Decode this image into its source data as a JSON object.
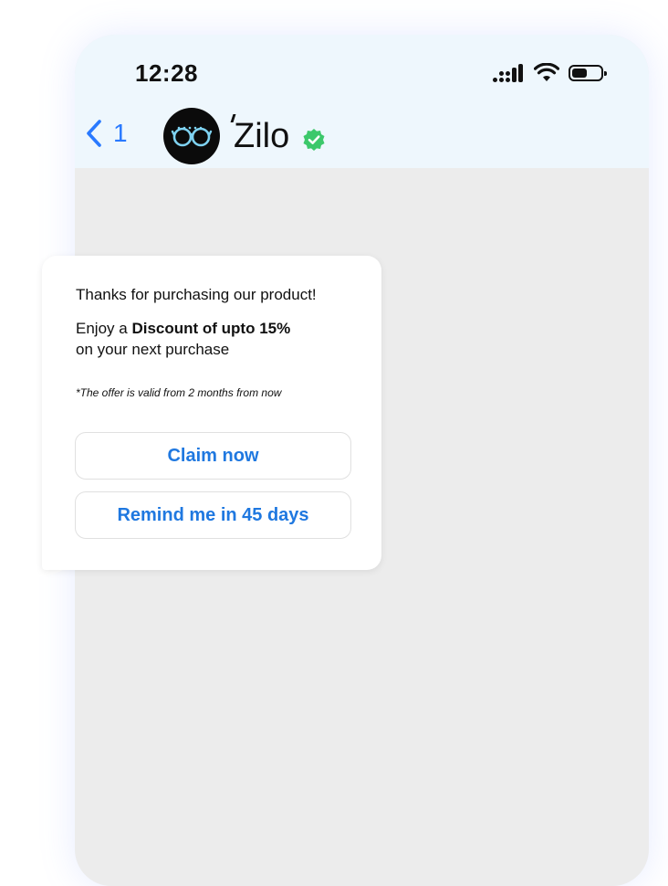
{
  "status_bar": {
    "time": "12:28",
    "icons": [
      "signal-icon",
      "wifi-icon",
      "battery-icon"
    ]
  },
  "header": {
    "back_count": "1",
    "brand_name": "Zilo",
    "avatar_icon": "glasses-icon",
    "verified_icon": "verified-badge-icon"
  },
  "message": {
    "line1": "Thanks for purchasing our product!",
    "line2_prefix": "Enjoy a ",
    "line2_bold": "Discount of upto 15%",
    "line3": "on your next purchase",
    "note": "*The offer is valid from 2 months from now",
    "buttons": [
      {
        "label": "Claim now"
      },
      {
        "label": "Remind me in 45 days"
      }
    ]
  },
  "colors": {
    "accent": "#1f78e0",
    "header_bg": "#eef7fd",
    "chat_bg": "#ececec",
    "verified": "#3cc86b"
  }
}
